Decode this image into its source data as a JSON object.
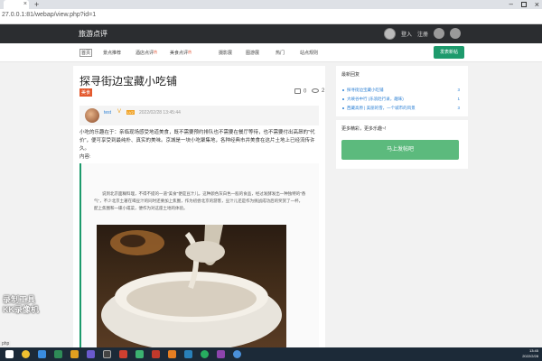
{
  "browser": {
    "tab_close": "×",
    "new_tab": "+",
    "address": "27.0.0.1:81/webap/view.php?id=1",
    "win_minimize": "–",
    "win_close": "×",
    "status_text": "php"
  },
  "header": {
    "site_title": "旅游点评",
    "login": "登入",
    "register": "注册"
  },
  "nav": {
    "items": [
      {
        "label": "首页",
        "hot": ""
      },
      {
        "label": "景点推荐",
        "hot": ""
      },
      {
        "label": "酒店点评",
        "hot": "热"
      },
      {
        "label": "美食点评",
        "hot": "热"
      },
      {
        "label": "摄影展",
        "hot": ""
      },
      {
        "label": "图游展",
        "hot": ""
      },
      {
        "label": "热门",
        "hot": ""
      },
      {
        "label": "站点规则",
        "hot": ""
      }
    ],
    "publish_button": "发表新帖"
  },
  "article": {
    "title": "探寻街边宝藏小吃铺",
    "category": "美食",
    "comment_count": "0",
    "view_count": "2",
    "author": "test",
    "v_mark": "V",
    "level": "LV2",
    "date": "2022/02/28 13:45:44",
    "summary": "小吃的乐趣在于：亲临现场感受地道美食，既不需要预约排队也不需要在餐厅等待，也不需要付出高昂的\"代价\"，便可享受到最纯朴、真实的美味。京城是一块小吃聚集地，各种经典市井美食在这片土地上已经流传许久。",
    "content_label": "内容:",
    "content_paragraph": "说到北京面糊料理，不得不提的一道\"美食\"便是豆汁儿，这种颜色灰白色一股的食品，经过发酵发出一种独特的\"香气\"，不少北京土著在喝豆汁的同时还要加上焦圈，作为初尝北京的游客，豆汁儿还是作为挑战成功后的奖赏了一杯，配上焦圈和一碟小咸菜，便作为对这座土地的体验。"
  },
  "sidebar": {
    "latest_heading": "最新回复",
    "latest_items": [
      {
        "text": "探寻街边宝藏小吃铺",
        "count": "3"
      },
      {
        "text": "大峡谷中行 (乐浪赴行录，趣味)",
        "count": "1"
      },
      {
        "text": "西藏高原 | 美丽的雪，一个城市的风景",
        "count": "3"
      }
    ],
    "share_heading": "更多精彩，更多乐趣~!",
    "share_button": "马上发帖吧"
  },
  "watermark": {
    "line1": "录制工具",
    "line2": "KK录像机"
  },
  "taskbar": {
    "time": "13:45",
    "date": "2022/2/28"
  },
  "colors": {
    "header_bg": "#2b2d30",
    "accent_green": "#1d9a6c",
    "badge_orange": "#e4592e",
    "link_blue": "#2a7fd4"
  }
}
